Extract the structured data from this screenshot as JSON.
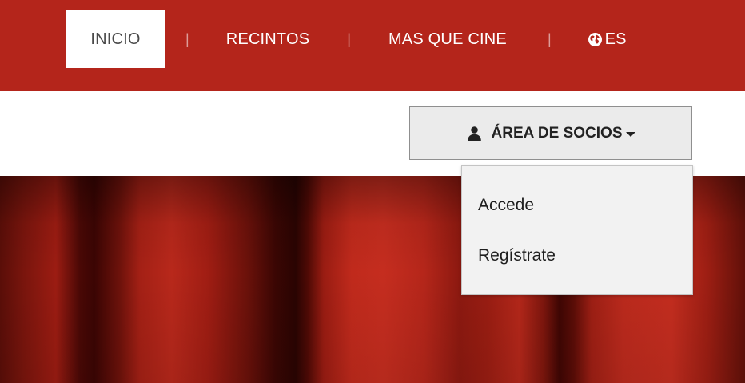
{
  "nav": {
    "items": [
      {
        "label": "INICIO",
        "active": true
      },
      {
        "label": "RECINTOS",
        "active": false
      },
      {
        "label": "MAS QUE CINE",
        "active": false
      },
      {
        "label": "ES",
        "active": false,
        "icon": "globe-icon"
      }
    ],
    "separator": "|"
  },
  "socios": {
    "label": "ÁREA DE SOCIOS",
    "icon": "user-icon",
    "caret": "caret-down-icon"
  },
  "dropdown": {
    "items": [
      {
        "label": "Accede"
      },
      {
        "label": "Regístrate"
      }
    ]
  },
  "colors": {
    "brand_red": "#b4251b",
    "button_bg": "#ebebeb",
    "dropdown_bg": "#f2f2f2"
  }
}
